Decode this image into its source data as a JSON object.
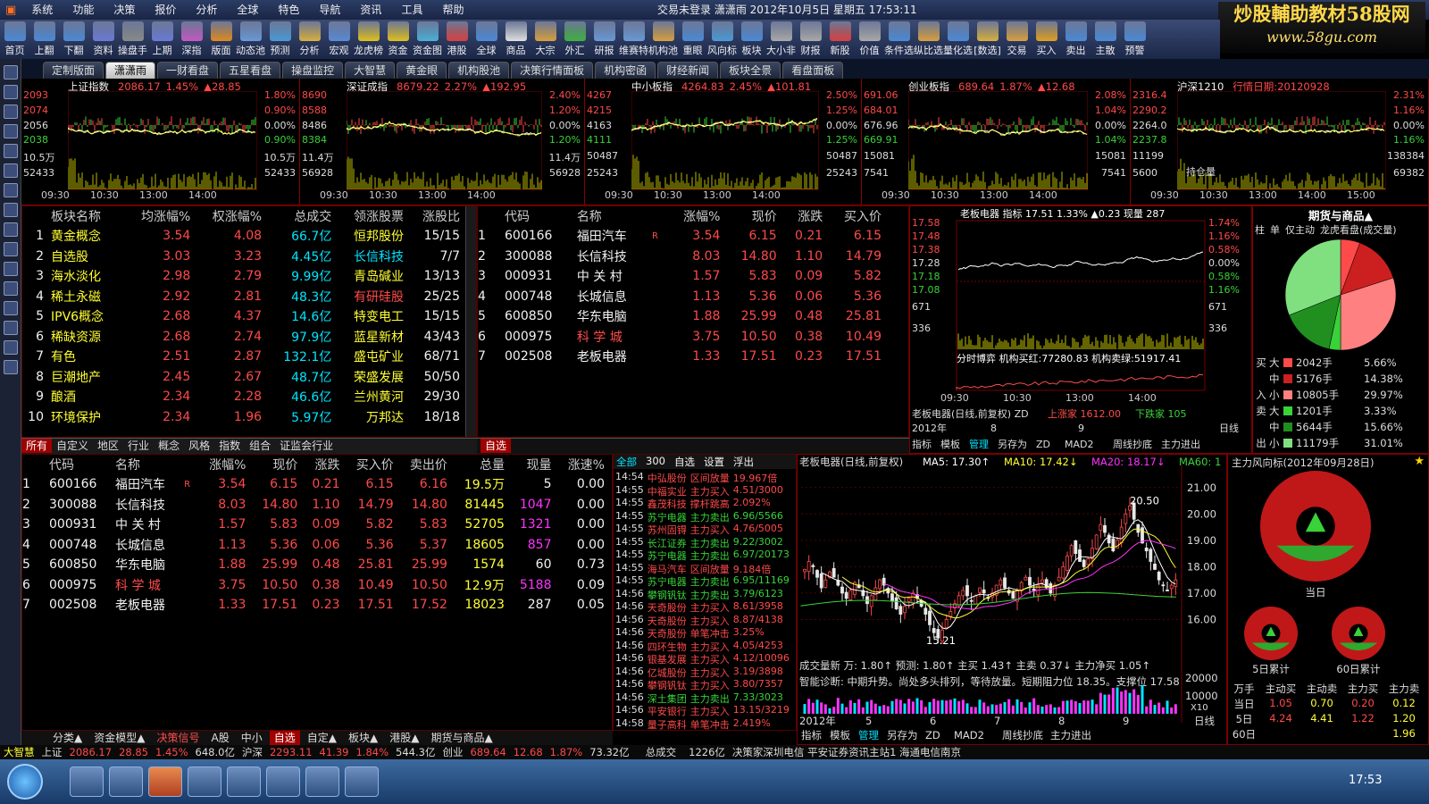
{
  "menu": [
    "系统",
    "功能",
    "决策",
    "报价",
    "分析",
    "全球",
    "特色",
    "导航",
    "资讯",
    "工具",
    "帮助"
  ],
  "title": "交易未登录   潇潇雨  2012年10月5日  星期五  17:53:11",
  "menu_right": [
    "闪电手",
    "信息",
    "行"
  ],
  "watermark": {
    "line1": "炒股輔助教材58股网",
    "line2": "www.58gu.com"
  },
  "toolbar": [
    [
      "首页",
      "#4b8ad8"
    ],
    [
      "上翻",
      "#4b8ad8"
    ],
    [
      "下翻",
      "#4b8ad8"
    ],
    [
      "资料",
      "#6a7bd8"
    ],
    [
      "操盘手",
      "#8a8a8a"
    ],
    [
      "上期",
      "#6a7bd8"
    ],
    [
      "深指",
      "#c45ac4"
    ],
    [
      "版面",
      "#e08a20"
    ],
    [
      "动态池",
      "#6a9ad8"
    ],
    [
      "预测",
      "#4b9ad8"
    ],
    [
      "分析",
      "#d8b040"
    ],
    [
      "宏观",
      "#5a8ad8"
    ],
    [
      "龙虎榜",
      "#e0c020"
    ],
    [
      "资金",
      "#e0c020"
    ],
    [
      "资金图",
      "#4bb0d8"
    ],
    [
      "港股",
      "#d84040"
    ],
    [
      "全球",
      "#4b8ad8"
    ],
    [
      "商品",
      "#e0e0e0"
    ],
    [
      "大宗",
      "#d8a040"
    ],
    [
      "外汇",
      "#40b040"
    ],
    [
      "研报",
      "#6a9ad8"
    ],
    [
      "维赛特",
      "#6a9ad8"
    ],
    [
      "机构池",
      "#d8a040"
    ],
    [
      "重眼",
      "#4b8ad8"
    ],
    [
      "风向标",
      "#4b9ad8"
    ],
    [
      "板块",
      "#4b8ad8"
    ],
    [
      "大小非",
      "#aaaaaa"
    ],
    [
      "财报",
      "#aaaaaa"
    ],
    [
      "新股",
      "#d84040"
    ],
    [
      "价值",
      "#aaaaaa"
    ],
    [
      "条件选",
      "#4b8ad8"
    ],
    [
      "纵比选",
      "#d8a040"
    ],
    [
      "量化选",
      "#4b8ad8"
    ],
    [
      "[数选]",
      "#d8b040"
    ],
    [
      "交易",
      "#d8a040"
    ],
    [
      "买入",
      "#e0a020"
    ],
    [
      "卖出",
      "#4b8ad8"
    ],
    [
      "主散",
      "#4b8ad8"
    ],
    [
      "预警",
      "#4b8ad8"
    ]
  ],
  "tabs": [
    "定制版面",
    "潇潇雨",
    "一财看盘",
    "五星看盘",
    "操盘监控",
    "大智慧",
    "黄金眼",
    "机构股池",
    "决策行情面板",
    "机构密函",
    "财经新闻",
    "板块全景",
    "看盘面板"
  ],
  "active_tab": 1,
  "mini_charts": [
    {
      "title": "上证指数",
      "val": "2086.17",
      "pct": "1.45%",
      "chg": "▲28.85",
      "left": [
        "2093",
        "2074",
        "2056",
        "2038",
        "10.5万",
        "52433"
      ],
      "right": [
        "1.80%",
        "0.90%",
        "0.00%",
        "0.90%",
        "10.5万",
        "52433"
      ],
      "times": [
        "09:30",
        "10:30",
        "13:00",
        "14:00"
      ]
    },
    {
      "title": "深证成指",
      "val": "8679.22",
      "pct": "2.27%",
      "chg": "▲192.95",
      "left": [
        "8690",
        "8588",
        "8486",
        "8384",
        "11.4万",
        "56928"
      ],
      "right": [
        "2.40%",
        "1.20%",
        "0.00%",
        "1.20%",
        "11.4万",
        "56928"
      ],
      "times": [
        "09:30",
        "10:30",
        "13:00",
        "14:00"
      ]
    },
    {
      "title": "中小板指",
      "val": "4264.83",
      "pct": "2.45%",
      "chg": "▲101.81",
      "left": [
        "4267",
        "4215",
        "4163",
        "4111",
        "50487",
        "25243"
      ],
      "right": [
        "2.50%",
        "1.25%",
        "0.00%",
        "1.25%",
        "50487",
        "25243"
      ],
      "times": [
        "09:30",
        "10:30",
        "13:00",
        "14:00"
      ]
    },
    {
      "title": "创业板指",
      "val": "689.64",
      "pct": "1.87%",
      "chg": "▲12.68",
      "left": [
        "691.06",
        "684.01",
        "676.96",
        "669.91",
        "15081",
        "7541"
      ],
      "right": [
        "2.08%",
        "1.04%",
        "0.00%",
        "1.04%",
        "15081",
        "7541"
      ],
      "times": [
        "09:30",
        "10:30",
        "13:00",
        "14:00"
      ]
    },
    {
      "title": "沪深1210",
      "val": "行情日期:20120928",
      "pct": "",
      "chg": "",
      "left": [
        "2316.4",
        "2290.2",
        "2264.0",
        "2237.8",
        "11199",
        "5600"
      ],
      "right": [
        "2.31%",
        "1.16%",
        "0.00%",
        "1.16%",
        "138384",
        "69382"
      ],
      "times": [
        "09:30",
        "10:30",
        "13:00",
        "14:00",
        "15:00"
      ],
      "extra": "持仓量"
    }
  ],
  "sector_table": {
    "headers": [
      "板块名称",
      "均涨幅%",
      "权涨幅%",
      "总成交",
      "领涨股票",
      "涨股比"
    ],
    "rows": [
      [
        "1",
        "黄金概念",
        "3.54",
        "4.08",
        "66.7亿",
        "恒邦股份",
        "15/15"
      ],
      [
        "2",
        "自选股",
        "3.03",
        "3.23",
        "4.45亿",
        "长信科技",
        "7/7"
      ],
      [
        "3",
        "海水淡化",
        "2.98",
        "2.79",
        "9.99亿",
        "青岛碱业",
        "13/13"
      ],
      [
        "4",
        "稀土永磁",
        "2.92",
        "2.81",
        "48.3亿",
        "有研硅股",
        "25/25"
      ],
      [
        "5",
        "IPV6概念",
        "2.68",
        "4.37",
        "14.6亿",
        "特变电工",
        "15/15"
      ],
      [
        "6",
        "稀缺资源",
        "2.68",
        "2.74",
        "97.9亿",
        "蓝星新材",
        "43/43"
      ],
      [
        "7",
        "有色",
        "2.51",
        "2.87",
        "132.1亿",
        "盛屯矿业",
        "68/71"
      ],
      [
        "8",
        "巨潮地产",
        "2.45",
        "2.67",
        "48.7亿",
        "荣盛发展",
        "50/50"
      ],
      [
        "9",
        "酿酒",
        "2.34",
        "2.28",
        "46.6亿",
        "兰州黄河",
        "29/30"
      ],
      [
        "10",
        "环境保护",
        "2.34",
        "1.96",
        "5.97亿",
        "万邦达",
        "18/18"
      ]
    ],
    "tabs": [
      "所有",
      "自定义",
      "地区",
      "行业",
      "概念",
      "风格",
      "指数",
      "组合",
      "证监会行业"
    ]
  },
  "stock_table_small": {
    "headers": [
      "代码",
      "名称",
      "",
      "涨幅%",
      "现价",
      "涨跌",
      "买入价"
    ],
    "rows": [
      [
        "1",
        "600166",
        "福田汽车",
        "R",
        "3.54",
        "6.15",
        "0.21",
        "6.15"
      ],
      [
        "2",
        "300088",
        "长信科技",
        "",
        "8.03",
        "14.80",
        "1.10",
        "14.79"
      ],
      [
        "3",
        "000931",
        "中 关 村",
        "",
        "1.57",
        "5.83",
        "0.09",
        "5.82"
      ],
      [
        "4",
        "000748",
        "长城信息",
        "",
        "1.13",
        "5.36",
        "0.06",
        "5.36"
      ],
      [
        "5",
        "600850",
        "华东电脑",
        "",
        "1.88",
        "25.99",
        "0.48",
        "25.81"
      ],
      [
        "6",
        "000975",
        "科 学 城",
        "",
        "3.75",
        "10.50",
        "0.38",
        "10.49"
      ],
      [
        "7",
        "002508",
        "老板电器",
        "",
        "1.33",
        "17.51",
        "0.23",
        "17.51"
      ]
    ],
    "tab": "自选"
  },
  "intraday": {
    "title": "老板电器",
    "label": "指标",
    "val": "17.51",
    "pct": "1.33%",
    "chg": "▲0.23",
    "vol": "现量 287",
    "left": [
      "17.58",
      "17.48",
      "17.38",
      "17.28",
      "17.18",
      "17.08",
      "671",
      "336"
    ],
    "right": [
      "1.74%",
      "1.16%",
      "0.58%",
      "0.00%",
      "0.58%",
      "1.16%",
      "671",
      "336"
    ],
    "times": [
      "09:30",
      "10:30",
      "13:00",
      "14:00"
    ],
    "game": "分时博弈  机构买红:77280.83  机构卖绿:51917.41",
    "kline_label": "老板电器(日线,前复权) ZD",
    "up_stop": "上涨家 1612.00",
    "down": "下跌家 105",
    "date": "2012年",
    "months": [
      "8",
      "9"
    ],
    "period": "日线"
  },
  "indicator_tabs": [
    "指标",
    "模板",
    "管理",
    "另存为",
    "ZD",
    "MAD2",
    "周线抄底",
    "主力进出"
  ],
  "futures": {
    "title": "期货与商品▲",
    "sub": [
      "柱",
      "单",
      "仅主动",
      "龙虎看盘(成交量)"
    ],
    "rows": [
      [
        "买",
        "大",
        "2042手",
        "5.66%",
        "#ff4a4a"
      ],
      [
        "",
        "中",
        "5176手",
        "14.38%",
        "#cc2020"
      ],
      [
        "入",
        "小",
        "10805手",
        "29.97%",
        "#ff8080"
      ],
      [
        "卖",
        "大",
        "1201手",
        "3.33%",
        "#39d239"
      ],
      [
        "",
        "中",
        "5644手",
        "15.66%",
        "#208f20"
      ],
      [
        "出",
        "小",
        "11179手",
        "31.01%",
        "#80e080"
      ]
    ]
  },
  "pie": [
    5.66,
    14.38,
    29.97,
    3.33,
    15.66,
    31.01
  ],
  "stock_table": {
    "headers": [
      "代码",
      "名称",
      "",
      "涨幅%",
      "现价",
      "涨跌",
      "买入价",
      "卖出价",
      "总量",
      "现量",
      "涨速%"
    ],
    "rows": [
      [
        "1",
        "600166",
        "福田汽车",
        "R",
        "3.54",
        "6.15",
        "0.21",
        "6.15",
        "6.16",
        "19.5万",
        "5",
        "0.00"
      ],
      [
        "2",
        "300088",
        "长信科技",
        "",
        "8.03",
        "14.80",
        "1.10",
        "14.79",
        "14.80",
        "81445",
        "1047",
        "0.00"
      ],
      [
        "3",
        "000931",
        "中 关 村",
        "",
        "1.57",
        "5.83",
        "0.09",
        "5.82",
        "5.83",
        "52705",
        "1321",
        "0.00"
      ],
      [
        "4",
        "000748",
        "长城信息",
        "",
        "1.13",
        "5.36",
        "0.06",
        "5.36",
        "5.37",
        "18605",
        "857",
        "0.00"
      ],
      [
        "5",
        "600850",
        "华东电脑",
        "",
        "1.88",
        "25.99",
        "0.48",
        "25.81",
        "25.99",
        "1574",
        "60",
        "0.73"
      ],
      [
        "6",
        "000975",
        "科 学 城",
        "",
        "3.75",
        "10.50",
        "0.38",
        "10.49",
        "10.50",
        "12.9万",
        "5188",
        "0.09"
      ],
      [
        "7",
        "002508",
        "老板电器",
        "",
        "1.33",
        "17.51",
        "0.23",
        "17.51",
        "17.52",
        "18023",
        "287",
        "0.05"
      ]
    ]
  },
  "news": {
    "tabs": [
      "全部",
      "300",
      "自选",
      "",
      "设置",
      "浮出"
    ],
    "rows": [
      [
        "14:54",
        "中弘股份",
        "区间放量",
        "19.967倍"
      ],
      [
        "14:55",
        "中福实业",
        "主力买入",
        "4.51/3000"
      ],
      [
        "14:55",
        "鑫茂科技",
        "撑杆跳高",
        "2.092%"
      ],
      [
        "14:55",
        "苏宁电器",
        "主力卖出",
        "6.96/5566"
      ],
      [
        "14:55",
        "苏州固锝",
        "主力买入",
        "4.76/5005"
      ],
      [
        "14:55",
        "长江证券",
        "主力卖出",
        "9.22/3002"
      ],
      [
        "14:55",
        "苏宁电器",
        "主力卖出",
        "6.97/20173"
      ],
      [
        "14:55",
        "海马汽车",
        "区间放量",
        "9.184倍"
      ],
      [
        "14:55",
        "苏宁电器",
        "主力卖出",
        "6.95/11169"
      ],
      [
        "14:56",
        "攀钢钒钛",
        "主力卖出",
        "3.79/6123"
      ],
      [
        "14:56",
        "天奇股份",
        "主力买入",
        "8.61/3958"
      ],
      [
        "14:56",
        "天奇股份",
        "主力买入",
        "8.87/4138"
      ],
      [
        "14:56",
        "天奇股份",
        "单笔冲击",
        "3.25%"
      ],
      [
        "14:56",
        "四环生物",
        "主力买入",
        "4.05/4253"
      ],
      [
        "14:56",
        "银基发展",
        "主力买入",
        "4.12/10096"
      ],
      [
        "14:56",
        "亿城股份",
        "主力买入",
        "3.19/3898"
      ],
      [
        "14:56",
        "攀钢钒钛",
        "主力买入",
        "3.80/7357"
      ],
      [
        "14:56",
        "深土集团",
        "主力卖出",
        "7.33/3023"
      ],
      [
        "14:56",
        "平安银行",
        "主力买入",
        "13.15/3219"
      ],
      [
        "14:58",
        "量子高科",
        "单笔冲击",
        "2.419%"
      ]
    ]
  },
  "kline": {
    "title": "老板电器(日线,前复权)",
    "ma": [
      [
        "MA5: 17.30↑",
        "#fff"
      ],
      [
        "MA10: 17.42↓",
        "#ffff33"
      ],
      [
        "MA20: 18.17↓",
        "#ff33ff"
      ],
      [
        "MA60: 1",
        "#39d239"
      ]
    ],
    "y": [
      "21.00",
      "20.00",
      "19.00",
      "18.00",
      "17.00",
      "16.00"
    ],
    "high": "20.50",
    "low": "15.21",
    "vol_label": "成交量新 万: 1.80↑  预测: 1.80↑  主买 1.43↑  主卖 0.37↓  主力净买 1.05↑",
    "diag": "智能诊断: 中期升势。尚处多头排列，等待放量。短期阻力位 18.35。支撑位 17.58",
    "vy": [
      "20000",
      "10000"
    ],
    "x10": "X10",
    "date": "2012年",
    "months": [
      "5",
      "6",
      "7",
      "8",
      "9"
    ],
    "period": "日线",
    "close": [
      17.9,
      18.2,
      18.0,
      17.6,
      17.2,
      17.5,
      17.8,
      17.6,
      17.3,
      17.0,
      16.8,
      17.1,
      17.4,
      17.2,
      16.9,
      16.6,
      16.9,
      17.2,
      17.5,
      17.3,
      17.0,
      16.7,
      16.4,
      16.2,
      16.5,
      16.8,
      17.0,
      16.8,
      16.5,
      16.2,
      15.8,
      15.5,
      15.3,
      15.6,
      16.0,
      16.3,
      16.6,
      16.9,
      17.1,
      16.9,
      16.7,
      16.9,
      17.2,
      17.0,
      16.8,
      17.0,
      17.3,
      17.5,
      17.2,
      17.0,
      16.8,
      17.1,
      17.4,
      17.6,
      17.3,
      17.1,
      17.3,
      17.5,
      17.2,
      17.0,
      17.3,
      17.6,
      18.0,
      18.4,
      18.8,
      18.5,
      18.2,
      18.0,
      18.3,
      18.7,
      19.2,
      19.6,
      19.3,
      18.9,
      18.6,
      19.0,
      19.5,
      20.0,
      20.3,
      19.8,
      19.3,
      18.9,
      18.6,
      18.2,
      17.9,
      17.5,
      17.3,
      17.1,
      17.3,
      17.5
    ]
  },
  "force": {
    "title": "主力风向标(2012年09月28日)",
    "labels": [
      "当日",
      "5日累计",
      "60日累计"
    ],
    "head": [
      "万手",
      "主动买",
      "主动卖",
      "主力买",
      "主力卖"
    ],
    "rows": [
      [
        "当日",
        "1.05",
        "0.70",
        "0.20",
        "0.12"
      ],
      [
        "5日",
        "4.24",
        "4.41",
        "1.22",
        "1.20"
      ],
      [
        "60日",
        "",
        "",
        "",
        "1.96"
      ]
    ]
  },
  "bottom_tabs": [
    "分类▲",
    "资金模型▲",
    "决策信号",
    "A股",
    "中小",
    "自选",
    "自定▲",
    "板块▲",
    "港股▲",
    "期货与商品▲"
  ],
  "status": [
    [
      "大智慧",
      "#ffff33"
    ],
    [
      "上证",
      "#ddd"
    ],
    [
      "2086.17",
      "#ff4a4a"
    ],
    [
      "28.85",
      "#ff4a4a"
    ],
    [
      "1.45%",
      "#ff4a4a"
    ],
    [
      "648.0亿",
      "#ddd"
    ],
    [
      "沪深",
      "#ddd"
    ],
    [
      "2293.11",
      "#ff4a4a"
    ],
    [
      "41.39",
      "#ff4a4a"
    ],
    [
      "1.84%",
      "#ff4a4a"
    ],
    [
      "544.3亿",
      "#ddd"
    ],
    [
      "创业",
      "#ddd"
    ],
    [
      "689.64",
      "#ff4a4a"
    ],
    [
      "12.68",
      "#ff4a4a"
    ],
    [
      "1.87%",
      "#ff4a4a"
    ],
    [
      "73.32亿",
      "#ddd"
    ],
    [
      "总成交",
      "#ddd"
    ],
    [
      "1226亿",
      "#ddd"
    ],
    [
      "决策家深圳电信  平安证券资讯主站1  海通电信南京",
      "#ddd"
    ]
  ],
  "clock": "17:53"
}
